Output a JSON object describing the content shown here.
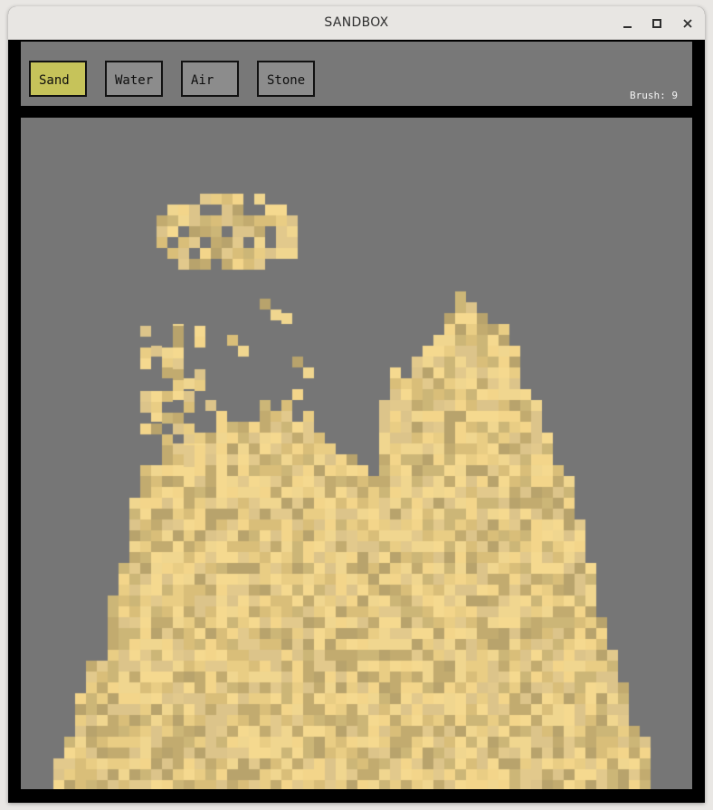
{
  "window": {
    "title": "SANDBOX"
  },
  "toolbar": {
    "tools": [
      {
        "label": "Sand",
        "active": true
      },
      {
        "label": "Water",
        "active": false
      },
      {
        "label": "Air",
        "active": false
      },
      {
        "label": "Stone",
        "active": false
      }
    ],
    "brush_label": "Brush: 9"
  },
  "canvas": {
    "background_color": "#767676",
    "sand_palette": [
      "#f3d58a",
      "#e9cd84",
      "#d9be79",
      "#c2ab6f",
      "#b8a36c",
      "#f0d68f",
      "#e2c98c",
      "#ccb677",
      "#f5d98f",
      "#dcc48a"
    ],
    "toolbar_active_color": "#c6c35a"
  }
}
